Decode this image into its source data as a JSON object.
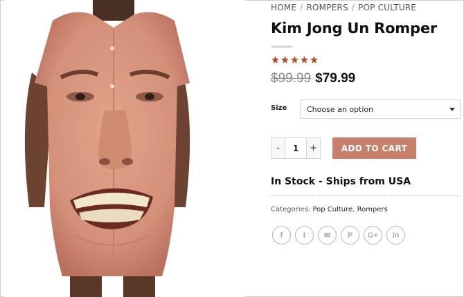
{
  "breadcrumb": {
    "items": [
      "HOME",
      "ROMPERS",
      "POP CULTURE"
    ],
    "separator": "/"
  },
  "product": {
    "title": "Kim Jong Un Romper",
    "rating_stars": 5,
    "rating_max": 5,
    "old_price": "$99.99",
    "price": "$79.99",
    "image_icon": "romper-product-photo"
  },
  "options": {
    "size_label": "Size",
    "size_select_value": "Choose an option"
  },
  "cart": {
    "qty_minus": "-",
    "qty_value": "1",
    "qty_plus": "+",
    "add_label": "ADD TO CART",
    "button_color": "#c7806a"
  },
  "stock_text": "In Stock - Ships from USA",
  "categories": {
    "label": "Categories:",
    "items": [
      "Pop Culture",
      "Rompers"
    ],
    "separator": ","
  },
  "social": {
    "icons": [
      "facebook-icon",
      "twitter-icon",
      "email-icon",
      "pinterest-icon",
      "google-plus-icon",
      "linkedin-icon"
    ],
    "glyphs": [
      "f",
      "t",
      "✉",
      "P",
      "G+",
      "in"
    ]
  },
  "colors": {
    "star": "#b5502c",
    "accent": "#c7806a",
    "text": "#111111"
  }
}
